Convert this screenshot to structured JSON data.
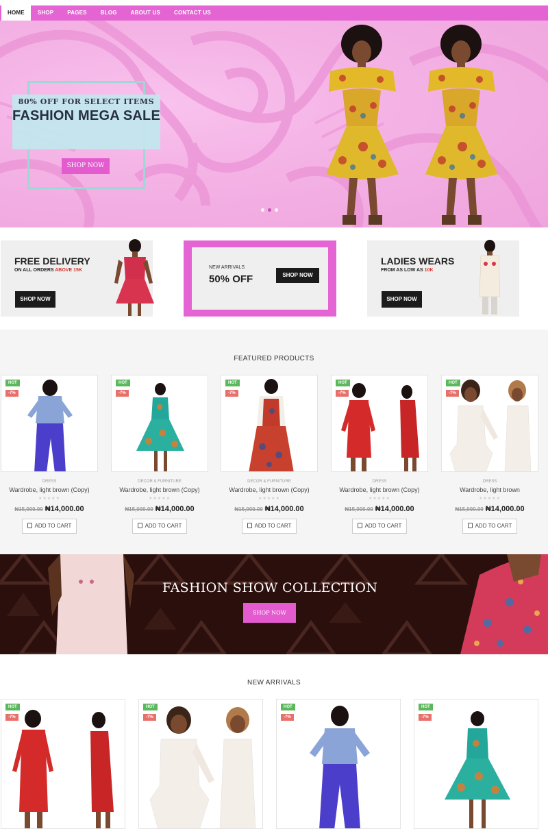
{
  "nav": {
    "items": [
      "HOME",
      "SHOP",
      "PAGES",
      "BLOG",
      "ABOUT US",
      "CONTACT US"
    ],
    "active": "HOME"
  },
  "hero": {
    "subtitle": "80% OFF FOR SELECT ITEMS",
    "title": "FASHION MEGA SALE",
    "button": "SHOP NOW",
    "slides": 3,
    "active_slide": 2
  },
  "promos": {
    "left": {
      "title": "FREE DELIVERY",
      "sub_prefix": "ON ALL ORDERS",
      "sub_highlight": "ABOVE 15K",
      "button": "SHOP NOW"
    },
    "middle": {
      "sub": "NEW ARRIVALS",
      "title": "50% OFF",
      "button": "SHOP NOW"
    },
    "right": {
      "title": "LADIES WEARS",
      "sub_prefix": "FROM AS LOW AS",
      "sub_highlight": "10K",
      "button": "SHOP NOW"
    }
  },
  "featured": {
    "title": "FEATURED PRODUCTS",
    "products": [
      {
        "hot": "HOT",
        "discount": "-7%",
        "category": "DRESS",
        "name": "Wardrobe, light brown (Copy)",
        "old_price": "₦15,000.00",
        "price": "₦14,000.00",
        "cart": "ADD TO CART"
      },
      {
        "hot": "HOT",
        "discount": "-7%",
        "category": "DECOR & FURNITURE",
        "name": "Wardrobe, light brown (Copy)",
        "old_price": "₦15,000.00",
        "price": "₦14,000.00",
        "cart": "ADD TO CART"
      },
      {
        "hot": "HOT",
        "discount": "-7%",
        "category": "DECOR & FURNITURE",
        "name": "Wardrobe, light brown (Copy)",
        "old_price": "₦15,000.00",
        "price": "₦14,000.00",
        "cart": "ADD TO CART"
      },
      {
        "hot": "HOT",
        "discount": "-7%",
        "category": "DRESS",
        "name": "Wardrobe, light brown (Copy)",
        "old_price": "₦15,000.00",
        "price": "₦14,000.00",
        "cart": "ADD TO CART"
      },
      {
        "hot": "HOT",
        "discount": "-7%",
        "category": "DRESS",
        "name": "Wardrobe, light brown",
        "old_price": "₦15,000.00",
        "price": "₦14,000.00",
        "cart": "ADD TO CART"
      }
    ]
  },
  "show": {
    "title": "FASHION SHOW COLLECTION",
    "button": "SHOP NOW"
  },
  "new_arrivals": {
    "title": "NEW ARRIVALS",
    "products": [
      {
        "hot": "HOT",
        "discount": "-7%"
      },
      {
        "hot": "HOT",
        "discount": "-7%"
      },
      {
        "hot": "HOT",
        "discount": "-7%"
      },
      {
        "hot": "HOT",
        "discount": "-7%"
      }
    ]
  },
  "colors": {
    "accent": "#e364d2",
    "button_pink": "#e35bcf",
    "hot": "#5cb85c",
    "discount": "#e8706a",
    "dark": "#1b1b1b"
  }
}
